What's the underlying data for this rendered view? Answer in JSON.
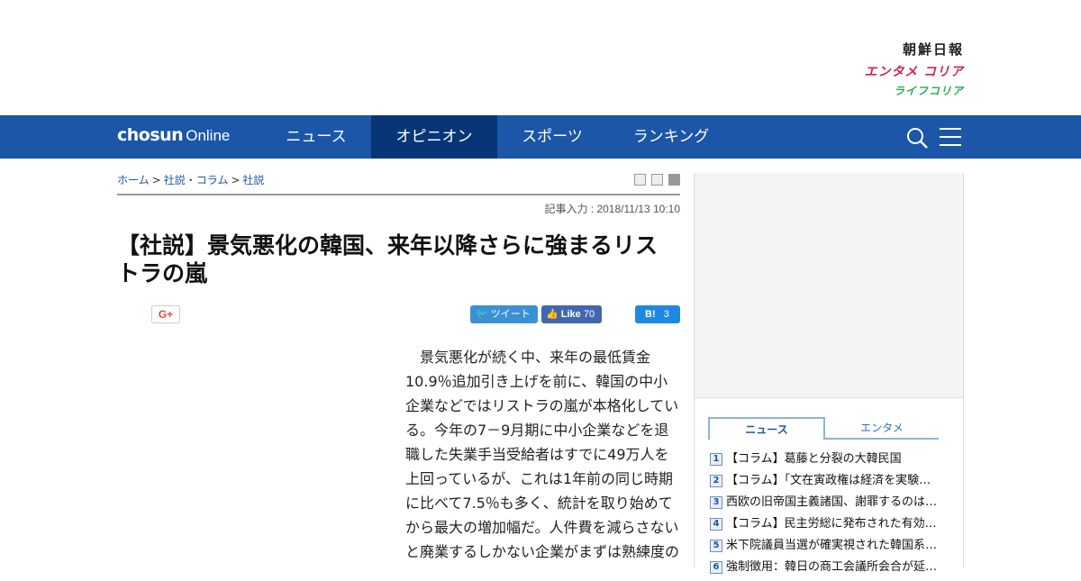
{
  "header": {
    "brand_chosun": "朝鮮日報",
    "brand_entame": "エンタメ コリア",
    "brand_life": "ライフコリア"
  },
  "nav": {
    "logo_bold": "chosun",
    "logo_light": "Online",
    "items": [
      "ニュース",
      "オピニオン",
      "スポーツ",
      "ランキング"
    ],
    "active": "オピニオン",
    "search_icon": "search-icon",
    "menu_icon": "hamburger-menu-icon",
    "accent_color": "#1b56a8",
    "active_color": "#073576"
  },
  "breadcrumb": {
    "home": "ホーム",
    "sep": ">",
    "section": "社説・コラム",
    "current": "社説"
  },
  "article": {
    "date": "記事入力 : 2018/11/13 10:10",
    "title": "【社説】景気悪化の韓国、来年以降さらに強まるリストラの嵐",
    "body": "　景気悪化が続く中、来年の最低賃金10.9％追加引き上げを前に、韓国の中小企業などではリストラの嵐が本格化している。今年の7－9月期に中小企業などを退職した失業手当受給者はすでに49万人を上回っているが、これは1年前の同じ時期に比べて7.5％も多く、統計を取り始めてから最大の増加幅だ。人件費を減らさないと廃業するしかない企業がまずは熟練度の"
  },
  "share": {
    "gplus": "G+",
    "tweet": "ツイート",
    "like": "Like",
    "like_count": "70",
    "hatena": "B!",
    "hatena_count": "3"
  },
  "sidebar": {
    "tabs": [
      "ニュース",
      "エンタメ"
    ],
    "ranking": [
      {
        "n": "1",
        "text": "【コラム】葛藤と分裂の大韓民国"
      },
      {
        "n": "2",
        "text": "【コラム】「文在寅政権は経済を実験…"
      },
      {
        "n": "3",
        "text": "西欧の旧帝国主義諸国、謝罪するのは…"
      },
      {
        "n": "4",
        "text": "【コラム】民主労総に発布された有効…"
      },
      {
        "n": "5",
        "text": "米下院議員当選が確実視された韓国系…"
      },
      {
        "n": "6",
        "text": "強制徴用：韓日の商工会議所会合が延…"
      }
    ]
  }
}
